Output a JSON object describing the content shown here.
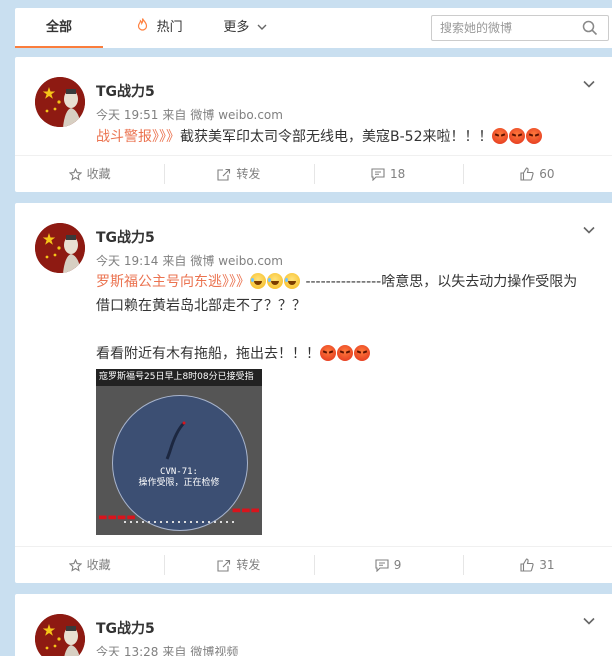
{
  "tabs": {
    "all": "全部",
    "hot": "热门",
    "more": "更多"
  },
  "search": {
    "placeholder": "搜索她的微博"
  },
  "posts": [
    {
      "user": "TG战力5",
      "time": "今天 19:51",
      "source_prefix": "来自",
      "source": "微博 weibo.com",
      "text_link": "战斗警报》》》",
      "text": "截获美军印太司令部无线电，美寇B-52来啦！！！",
      "collect": "收藏",
      "repost": "转发",
      "comments": "18",
      "likes": "60"
    },
    {
      "user": "TG战力5",
      "time": "今天 19:14",
      "source_prefix": "来自",
      "source": "微博 weibo.com",
      "text_link": "罗斯福公主号向东逃》》》",
      "text_line1_tail": " ---------------啥意思，以失去动力操作受限为",
      "text_line2": "借口赖在黄岩岛北部走不了？？？",
      "text_line3": "看看附近有木有拖船，拖出去！！！",
      "image_title": "寇罗斯福号25日早上8时08分已接受指",
      "image_caption_1": "CVN-71:",
      "image_caption_2": "操作受限，正在检修",
      "collect": "收藏",
      "repost": "转发",
      "comments": "9",
      "likes": "31"
    },
    {
      "user": "TG战力5",
      "time": "今天 13:28",
      "source_prefix": "来自",
      "source": "微博视频"
    }
  ],
  "icons": {
    "hot": "flame-icon",
    "more": "chevron-down-icon",
    "search": "search-icon",
    "caret": "chevron-down-icon",
    "collect": "star-icon",
    "repost": "repost-icon",
    "comment": "comment-icon",
    "like": "thumbs-up-icon"
  },
  "colors": {
    "accent": "#fa7d3c",
    "link": "#eb7350",
    "page_bg": "#c9dff0"
  }
}
